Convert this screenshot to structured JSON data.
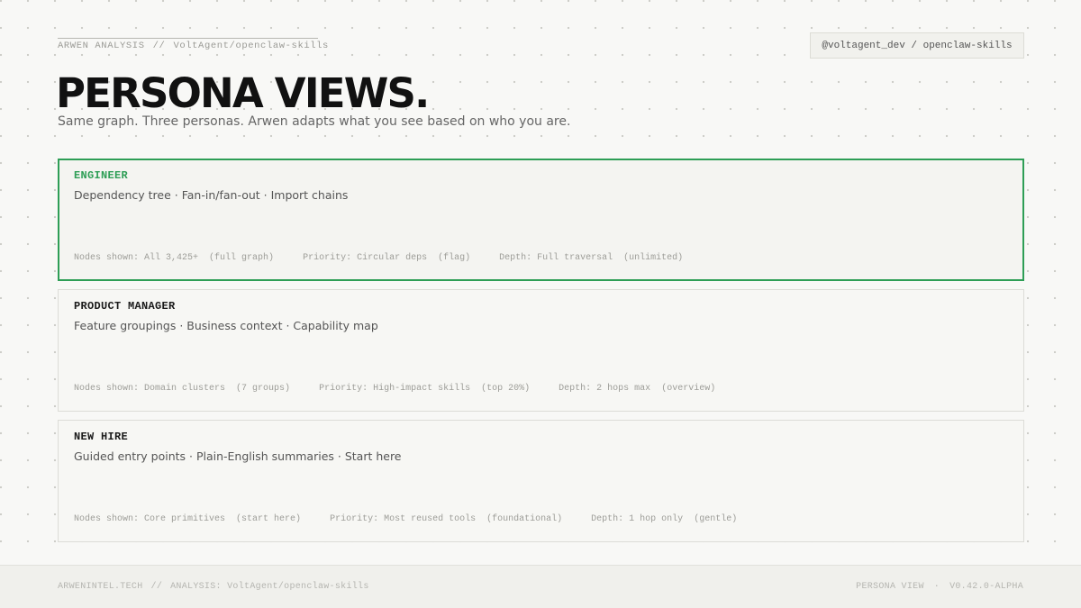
{
  "header": {
    "brand": "ARWEN ANALYSIS",
    "separator": "//",
    "repo_path": "VoltAgent/openclaw-skills",
    "repo_badge": "@voltagent_dev / openclaw-skills"
  },
  "title": "PERSONA VIEWS.",
  "subtitle": "Same graph. Three personas. Arwen adapts what you see based on who you are.",
  "accent_color": "#2e9e56",
  "personas": [
    {
      "role": "ENGINEER",
      "description": "Dependency tree · Fan-in/fan-out · Import chains",
      "active": true,
      "nodes_label": "Nodes shown:",
      "nodes_value": "All 3,425+",
      "nodes_note": "(full graph)",
      "priority_label": "Priority:",
      "priority_value": "Circular deps",
      "priority_note": "(flag)",
      "depth_label": "Depth:",
      "depth_value": "Full traversal",
      "depth_note": "(unlimited)"
    },
    {
      "role": "PRODUCT MANAGER",
      "description": "Feature groupings · Business context · Capability map",
      "active": false,
      "nodes_label": "Nodes shown:",
      "nodes_value": "Domain clusters",
      "nodes_note": "(7 groups)",
      "priority_label": "Priority:",
      "priority_value": "High-impact skills",
      "priority_note": "(top 20%)",
      "depth_label": "Depth:",
      "depth_value": "2 hops max",
      "depth_note": "(overview)"
    },
    {
      "role": "NEW HIRE",
      "description": "Guided entry points · Plain-English summaries · Start here",
      "active": false,
      "nodes_label": "Nodes shown:",
      "nodes_value": "Core primitives",
      "nodes_note": "(start here)",
      "priority_label": "Priority:",
      "priority_value": "Most reused tools",
      "priority_note": "(foundational)",
      "depth_label": "Depth:",
      "depth_value": "1 hop only",
      "depth_note": "(gentle)"
    }
  ],
  "footer": {
    "site": "ARWENINTEL.TECH",
    "separator": "//",
    "analysis": "ANALYSIS: VoltAgent/openclaw-skills",
    "view": "PERSONA VIEW",
    "dot": "·",
    "version": "V0.42.0-ALPHA"
  }
}
